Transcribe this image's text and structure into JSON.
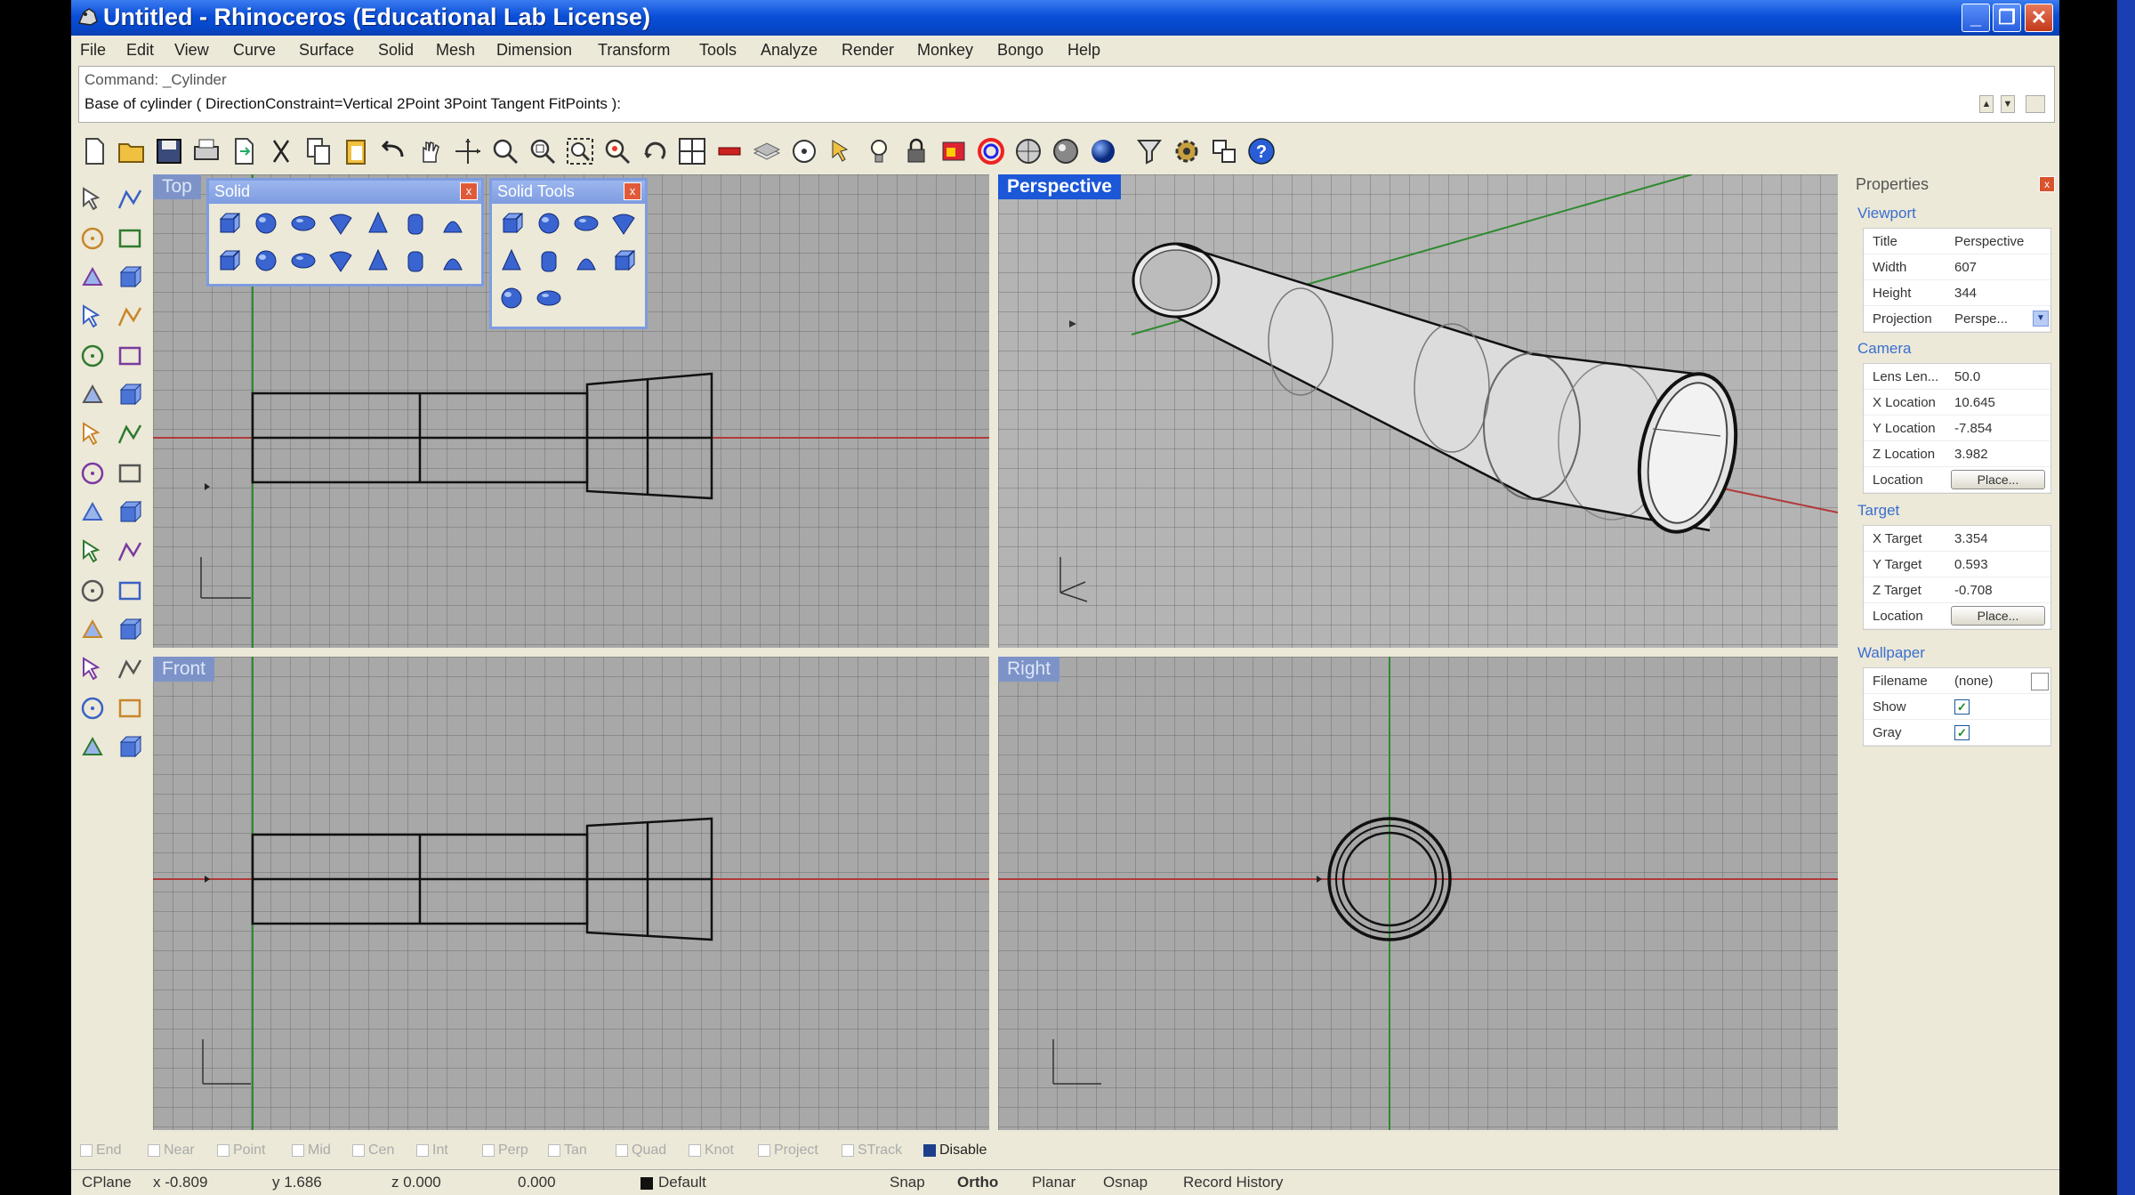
{
  "window": {
    "title": "Untitled - Rhinoceros (Educational Lab License)",
    "minimize": "_",
    "maximize": "❐",
    "close": "✕"
  },
  "menu": [
    "File",
    "Edit",
    "View",
    "Curve",
    "Surface",
    "Solid",
    "Mesh",
    "Dimension",
    "Transform",
    "Tools",
    "Analyze",
    "Render",
    "Monkey",
    "Bongo",
    "Help"
  ],
  "command": {
    "history": "Command: _Cylinder",
    "prompt": "Base of cylinder ( DirectionConstraint=Vertical  2Point  3Point  Tangent  FitPoints ):"
  },
  "main_toolbar_icons": [
    "new-icon",
    "open-icon",
    "save-icon",
    "print-icon",
    "import-icon",
    "cut-icon",
    "copy-icon",
    "paste-icon",
    "undo-icon",
    "pan-icon",
    "rotate-view-icon",
    "zoom-dynamic-icon",
    "zoom-window-icon",
    "zoom-extents-icon",
    "zoom-selected-icon",
    "undo-view-icon",
    "four-viewports-icon",
    "grid-snap-icon",
    "layer-icon",
    "object-properties-icon",
    "select-icon",
    "light-icon",
    "lock-icon",
    "color-icon",
    "render-icon",
    "shade-icon",
    "render-preview-icon",
    "sphere-icon",
    "filter-icon",
    "options-icon",
    "osnap-icon",
    "help-icon"
  ],
  "left_toolbar_icons": [
    "select-arrow-icon",
    "point-icon",
    "polyline-icon",
    "curve-icon",
    "circle-icon",
    "ellipse-icon",
    "arc-icon",
    "rectangle-icon",
    "polygon-icon",
    "fillet-icon",
    "surface-icon",
    "box-icon",
    "solid-icon",
    "mesh-icon",
    "extrude-icon",
    "boolean-icon",
    "offset-icon",
    "trim-icon",
    "split-icon",
    "join-icon",
    "group-icon",
    "explode-icon",
    "move-icon",
    "rotate-icon",
    "scale-icon",
    "mirror-icon",
    "array-icon",
    "dimension-icon",
    "text-icon",
    "render-globe-icon"
  ],
  "floating_toolbars": {
    "solid": {
      "title": "Solid",
      "close": "x"
    },
    "solid_tools": {
      "title": "Solid Tools",
      "close": "x"
    }
  },
  "viewports": {
    "top": {
      "label": "Top"
    },
    "perspective": {
      "label": "Perspective"
    },
    "front": {
      "label": "Front"
    },
    "right": {
      "label": "Right"
    }
  },
  "properties": {
    "header": "Properties",
    "close": "x",
    "sections": {
      "viewport": "Viewport",
      "camera": "Camera",
      "target": "Target",
      "wallpaper": "Wallpaper"
    },
    "viewport": [
      {
        "label": "Title",
        "value": "Perspective"
      },
      {
        "label": "Width",
        "value": "607"
      },
      {
        "label": "Height",
        "value": "344"
      },
      {
        "label": "Projection",
        "value": "Perspe..."
      }
    ],
    "camera": [
      {
        "label": "Lens Len...",
        "value": "50.0"
      },
      {
        "label": "X Location",
        "value": "10.645"
      },
      {
        "label": "Y Location",
        "value": "-7.854"
      },
      {
        "label": "Z Location",
        "value": "3.982"
      },
      {
        "label": "Location",
        "value": "Place..."
      }
    ],
    "target": [
      {
        "label": "X Target",
        "value": "3.354"
      },
      {
        "label": "Y Target",
        "value": "0.593"
      },
      {
        "label": "Z Target",
        "value": "-0.708"
      },
      {
        "label": "Location",
        "value": "Place..."
      }
    ],
    "wallpaper": [
      {
        "label": "Filename",
        "value": "(none)"
      },
      {
        "label": "Show",
        "checked": "✓"
      },
      {
        "label": "Gray",
        "checked": "✓"
      }
    ]
  },
  "osnaps": [
    {
      "label": "End",
      "on": false
    },
    {
      "label": "Near",
      "on": false
    },
    {
      "label": "Point",
      "on": false
    },
    {
      "label": "Mid",
      "on": false
    },
    {
      "label": "Cen",
      "on": false
    },
    {
      "label": "Int",
      "on": false
    },
    {
      "label": "Perp",
      "on": false
    },
    {
      "label": "Tan",
      "on": false
    },
    {
      "label": "Quad",
      "on": false
    },
    {
      "label": "Knot",
      "on": false
    },
    {
      "label": "Project",
      "on": false
    },
    {
      "label": "STrack",
      "on": false
    },
    {
      "label": "Disable",
      "on": true
    }
  ],
  "status": {
    "cplane": "CPlane",
    "x": "x -0.809",
    "y": "y 1.686",
    "z": "z 0.000",
    "extra": "0.000",
    "layer": "Default",
    "snap": "Snap",
    "ortho": "Ortho",
    "planar": "Planar",
    "osnap": "Osnap",
    "record_history": "Record History"
  },
  "colors": {
    "titlebar": "#0a4fd8",
    "viewport_bg": "#a8a8a8",
    "active_viewport_tab": "#1b57d6",
    "x_axis": "#b03030",
    "y_axis": "#2f8a2f",
    "selection_label": "#3a6ed0"
  }
}
